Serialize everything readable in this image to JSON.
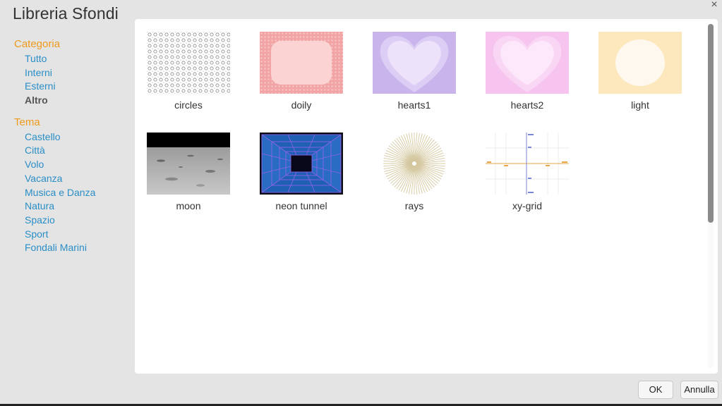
{
  "dialog": {
    "title": "Libreria Sfondi",
    "close_glyph": "×"
  },
  "sidebar": {
    "category_heading": "Categoria",
    "categories": [
      {
        "label": "Tutto"
      },
      {
        "label": "Interni"
      },
      {
        "label": "Esterni"
      },
      {
        "label": "Altro",
        "selected": true
      }
    ],
    "theme_heading": "Tema",
    "themes": [
      {
        "label": "Castello"
      },
      {
        "label": "Città"
      },
      {
        "label": "Volo"
      },
      {
        "label": "Vacanza"
      },
      {
        "label": "Musica e Danza"
      },
      {
        "label": "Natura"
      },
      {
        "label": "Spazio"
      },
      {
        "label": "Sport"
      },
      {
        "label": "Fondali Marini"
      }
    ]
  },
  "backdrops": [
    {
      "name": "circles",
      "icon": "circles-pattern"
    },
    {
      "name": "doily",
      "icon": "doily-frame"
    },
    {
      "name": "hearts1",
      "icon": "heart-purple"
    },
    {
      "name": "hearts2",
      "icon": "heart-pink"
    },
    {
      "name": "light",
      "icon": "light-circle"
    },
    {
      "name": "moon",
      "icon": "moon-surface"
    },
    {
      "name": "neon tunnel",
      "icon": "neon-tunnel"
    },
    {
      "name": "rays",
      "icon": "sun-rays"
    },
    {
      "name": "xy-grid",
      "icon": "xy-grid"
    }
  ],
  "buttons": {
    "ok": "OK",
    "cancel": "Annulla"
  },
  "colors": {
    "heading": "#f09a1d",
    "link": "#2a8ec7",
    "background": "#e4e4e4"
  }
}
